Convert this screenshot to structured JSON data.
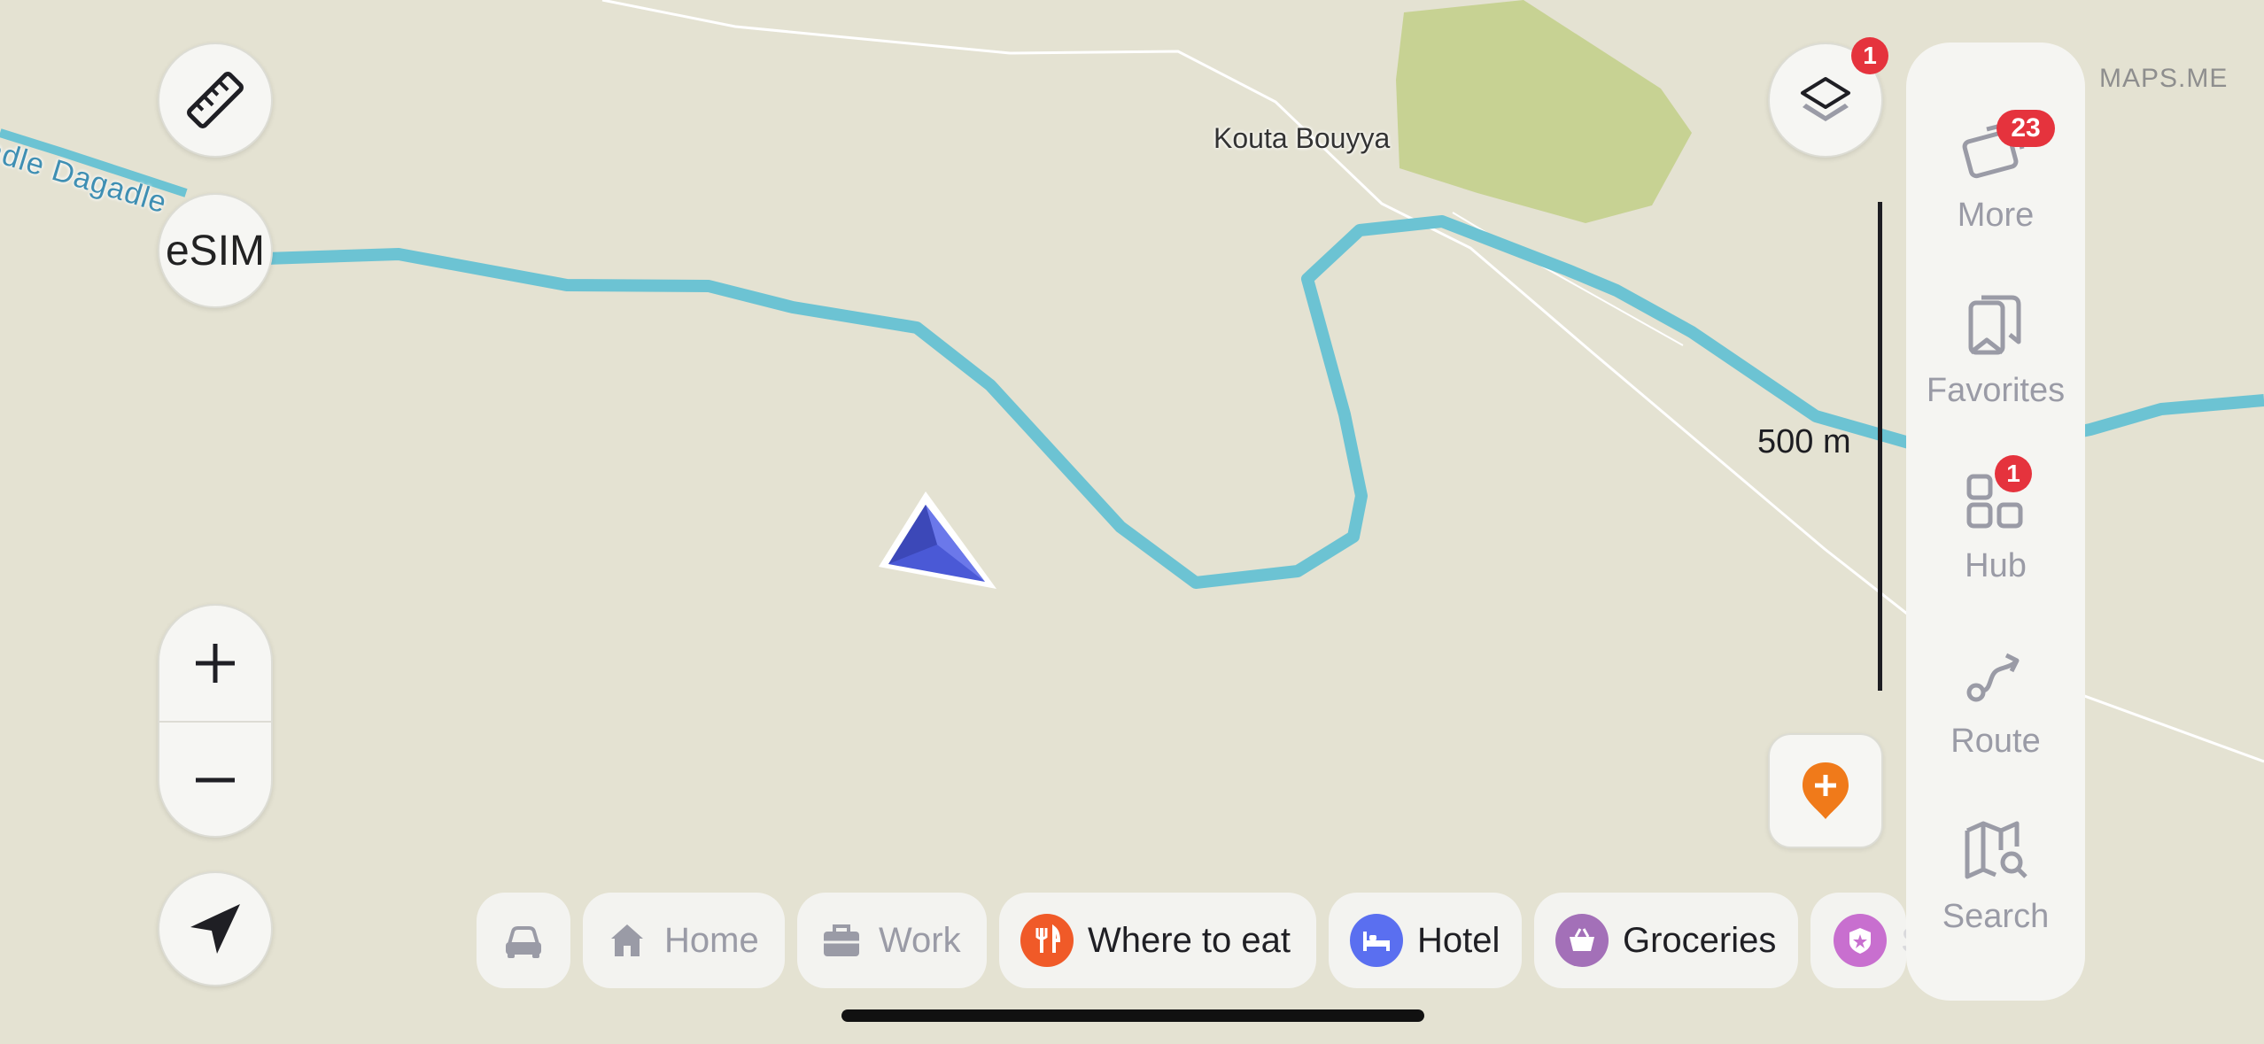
{
  "map": {
    "place_label": "Kouta Bouyya",
    "river_label": "adle  Dagadle",
    "brand": "MAPS.ME",
    "scale_label": "500 m",
    "colors": {
      "background": "#e4e2d2",
      "river": "#6cc3d3",
      "park": "#c7d293",
      "road": "#ffffff",
      "position_arrow": "#4a59d6"
    }
  },
  "controls": {
    "ruler_icon": "ruler-icon",
    "esim_label": "eSIM",
    "zoom_in_icon": "plus-icon",
    "zoom_out_icon": "minus-icon",
    "location_icon": "navigation-arrow-icon",
    "layers_icon": "layers-icon",
    "layers_badge": "1",
    "add_place_icon": "add-place-pin-icon"
  },
  "side_menu": {
    "items": [
      {
        "label": "More",
        "icon": "tickets-icon",
        "badge": "23"
      },
      {
        "label": "Favorites",
        "icon": "bookmarks-icon",
        "badge": ""
      },
      {
        "label": "Hub",
        "icon": "grid-icon",
        "badge": "1"
      },
      {
        "label": "Route",
        "icon": "route-icon",
        "badge": ""
      },
      {
        "label": "Search",
        "icon": "map-search-icon",
        "badge": ""
      }
    ]
  },
  "quick_chips": {
    "car_icon": "car-icon",
    "home": {
      "label": "Home",
      "icon": "house-icon"
    },
    "work": {
      "label": "Work",
      "icon": "briefcase-icon"
    },
    "eat": {
      "label": "Where to eat",
      "icon": "fork-knife-icon",
      "color": "#f05a28"
    },
    "hotel": {
      "label": "Hotel",
      "icon": "bed-icon",
      "color": "#5a6ff0"
    },
    "groceries": {
      "label": "Groceries",
      "icon": "basket-icon",
      "color": "#a370b8"
    },
    "partial": {
      "label": "S",
      "icon": "badge-icon",
      "color": "#c86fcf"
    }
  }
}
